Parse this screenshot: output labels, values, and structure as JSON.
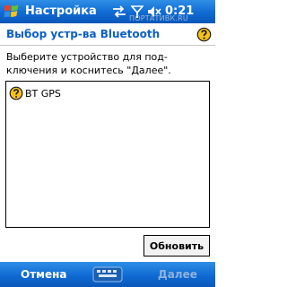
{
  "titlebar": {
    "app_title": "Настройка",
    "clock": "0:21",
    "watermark": "ПОРТАТИВК.RU"
  },
  "page": {
    "title": "Выбор устр-ва Bluetooth",
    "instructions": "Выберите устройство для под-ключения и коснитесь \"Далее\"."
  },
  "device_list": {
    "items": [
      {
        "name": "BT GPS",
        "icon": "unknown-device-question-icon"
      }
    ]
  },
  "buttons": {
    "refresh": "Обновить"
  },
  "menubar": {
    "left": "Отмена",
    "right": "Далее",
    "right_enabled": false
  },
  "colors": {
    "bar_blue": "#0f6ad3",
    "title_blue": "#0b5fc7",
    "disabled_softkey": "#8fb3dd"
  }
}
